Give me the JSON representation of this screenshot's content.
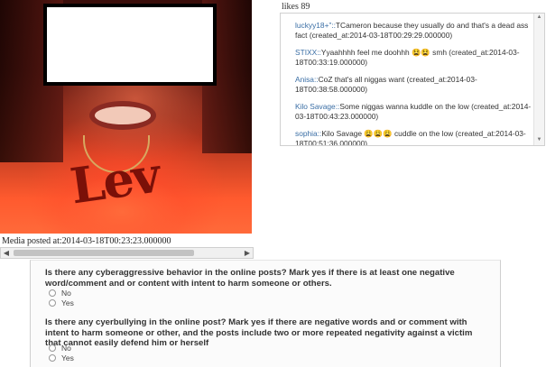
{
  "media": {
    "shirt_text": "Lev",
    "caption": "Media posted at:2014-03-18T00:23:23.000000"
  },
  "likes": "likes 89",
  "comments": [
    {
      "user": "luckyy18+”::",
      "text": "TCameron because they usually do and that's a dead ass fact (created_at:2014-03-18T00:29:29.000000)"
    },
    {
      "user": "STIXX::",
      "text": "Yyaahhhh feel me doohhh 😫😫 smh (created_at:2014-03-18T00:33:19.000000)"
    },
    {
      "user": "Anisa::",
      "text": "CoZ that's all niggas want (created_at:2014-03-18T00:38:58.000000)"
    },
    {
      "user": "Kilo Savage::",
      "text": "Some niggas wanna kuddle on the low (created_at:2014-03-18T00:43:23.000000)"
    },
    {
      "user": "sophia::",
      "text": "Kilo Savage 😩😩😩 cuddle on the low (created_at:2014-03-18T00:51:36.000000)"
    }
  ],
  "survey": {
    "q1": {
      "text": "Is there any cyberaggressive behavior in the online posts? Mark yes if there is at least one negative word/comment and or content with intent to harm someone or others.",
      "options": [
        "No",
        "Yes"
      ]
    },
    "q2": {
      "text": "Is there any cyerbullying in the online post? Mark yes if there are negative words and or comment with intent to harm someone or other, and the posts include two or more repeated negativity against a victim that cannot easily defend him or herself",
      "options": [
        "No",
        "Yes"
      ]
    }
  }
}
